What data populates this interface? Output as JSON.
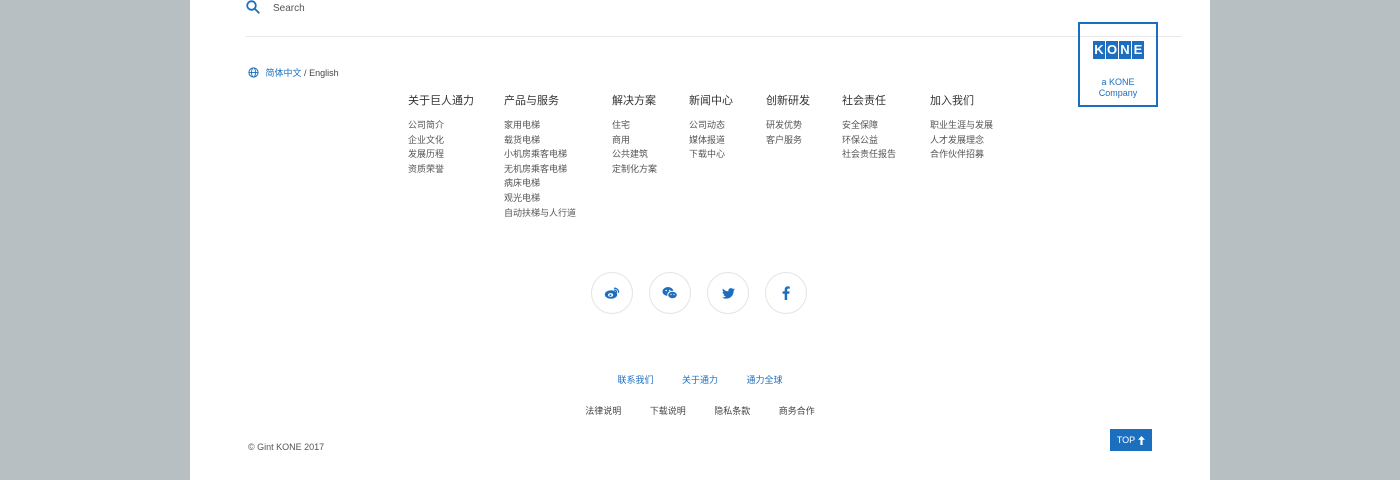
{
  "search": {
    "placeholder": "Search"
  },
  "language": {
    "current": "简体中文",
    "separator": "/",
    "other": "English"
  },
  "logo": {
    "letters": [
      "K",
      "O",
      "N",
      "E"
    ],
    "line1": "a KONE",
    "line2": "Company"
  },
  "nav": [
    {
      "title": "关于巨人通力",
      "items": [
        "公司简介",
        "企业文化",
        "发展历程",
        "资质荣誉"
      ]
    },
    {
      "title": "产品与服务",
      "items": [
        "家用电梯",
        "载货电梯",
        "小机房乘客电梯",
        "无机房乘客电梯",
        "病床电梯",
        "观光电梯",
        "自动扶梯与人行道"
      ]
    },
    {
      "title": "解决方案",
      "items": [
        "住宅",
        "商用",
        "公共建筑",
        "定制化方案"
      ]
    },
    {
      "title": "新闻中心",
      "items": [
        "公司动态",
        "媒体报道",
        "下载中心"
      ]
    },
    {
      "title": "创新研发",
      "items": [
        "研发优势",
        "客户服务"
      ]
    },
    {
      "title": "社会责任",
      "items": [
        "安全保障",
        "环保公益",
        "社会责任报告"
      ]
    },
    {
      "title": "加入我们",
      "items": [
        "职业生涯与发展",
        "人才发展理念",
        "合作伙伴招募"
      ]
    }
  ],
  "social": [
    "weibo-icon",
    "wechat-icon",
    "twitter-icon",
    "facebook-icon"
  ],
  "footer_links_primary": [
    "联系我们",
    "关于通力",
    "通力全球"
  ],
  "footer_links_secondary": [
    "法律说明",
    "下载说明",
    "隐私条款",
    "商务合作"
  ],
  "copyright": "© Gint KONE 2017",
  "top_button": {
    "label": "TOP"
  },
  "colors": {
    "brand": "#1c6fbf",
    "outer_bg": "#b8bfc2"
  }
}
